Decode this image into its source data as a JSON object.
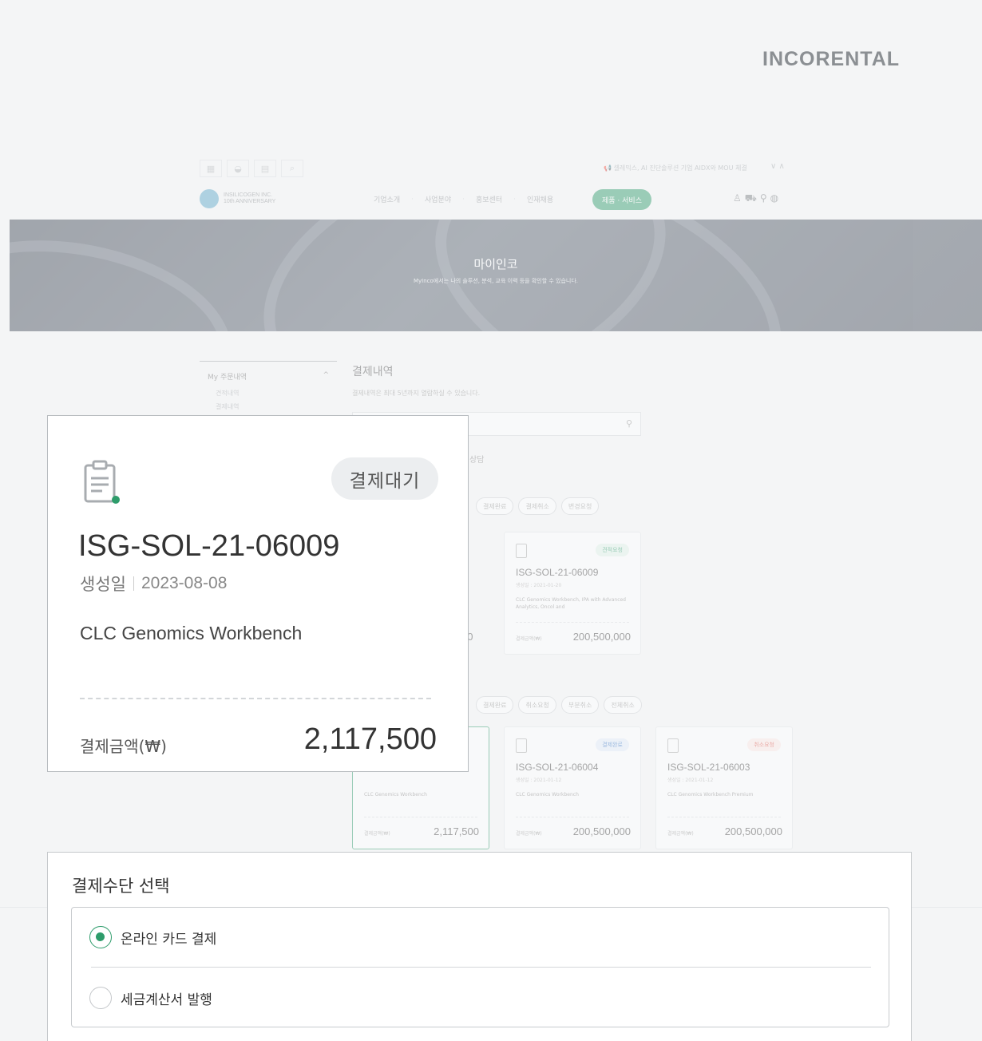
{
  "brand": {
    "logo_text": "INCORENTAL"
  },
  "background_site": {
    "notice": "📢 셀레믹스, AI 진단솔루션 기업 AIDX와 MOU 체결",
    "notice_arrows": "∨ ∧",
    "company": {
      "line1": "INSILICOGEN INC.",
      "line2": "10th ANNIVERSARY"
    },
    "nav": {
      "items": [
        "기업소개",
        "사업분야",
        "홍보센터",
        "인재채용"
      ],
      "active": "제품 · 서비스"
    },
    "hero": {
      "title": "마이인코",
      "subtitle": "MyInco에서는 나의 솔루션, 분석, 교육 이력 등을 확인할 수 있습니다."
    },
    "side_menu": {
      "group": "My 주문내역",
      "items": [
        "견적내역",
        "결제내역"
      ]
    },
    "main": {
      "title": "결제내역",
      "desc": "결제내역은 최대 5년까지 열람하실 수 있습니다.",
      "section_fragment": "상담",
      "chips_row1": [
        "결제완료",
        "결제취소",
        "변경요청"
      ],
      "chips_row2": [
        "결제완료",
        "취소요청",
        "부분취소",
        "전체취소"
      ],
      "cards_row1": [
        {
          "badge": "견적요청",
          "code": "ISG-SOL-21-06009",
          "date": "생성일 : 2021-01-20",
          "product": "CLC Genomics Workbench, IPA with Advanced Analytics, Oncol and",
          "amount_label": "결제금액(₩)",
          "amount": "200,500,000"
        }
      ],
      "cards_row2": [
        {
          "badge": "",
          "code": "",
          "date": "",
          "product": "CLC Genomics Workbench",
          "amount_label": "결제금액(₩)",
          "amount": "2,117,500"
        },
        {
          "badge": "결제완료",
          "code": "ISG-SOL-21-06004",
          "date": "생성일 : 2021-01-12",
          "product": "CLC Genomics Workbench",
          "amount_label": "결제금액(₩)",
          "amount": "200,500,000"
        },
        {
          "badge": "취소요청",
          "code": "ISG-SOL-21-06003",
          "date": "생성일 : 2021-01-12",
          "product": "CLC Genomics Workbench Premium",
          "amount_label": "결제금액(₩)",
          "amount": "200,500,000"
        }
      ],
      "partial_amount": "00"
    }
  },
  "card": {
    "status": "결제대기",
    "order_code": "ISG-SOL-21-06009",
    "created_label": "생성일",
    "created_date": "2023-08-08",
    "product": "CLC Genomics Workbench",
    "amount_label": "결제금액(₩)",
    "amount": "2,117,500",
    "icon": "clipboard-icon",
    "accent": "#2e9c6b"
  },
  "payment": {
    "title": "결제수단 선택",
    "options": [
      {
        "label": "온라인 카드 결제",
        "selected": true
      },
      {
        "label": "세금계산서 발행",
        "selected": false
      }
    ]
  }
}
